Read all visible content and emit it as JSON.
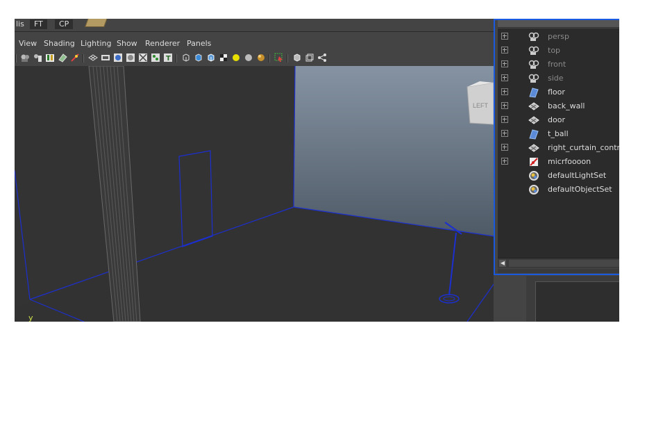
{
  "shelf": {
    "tabs": [
      {
        "label": "lis"
      },
      {
        "label": "FT"
      },
      {
        "label": "CP"
      }
    ]
  },
  "panel_menu": {
    "items": [
      "View",
      "Shading",
      "Lighting",
      "Show",
      "Renderer",
      "Panels"
    ]
  },
  "viewport": {
    "view_cube_label": "LEFT",
    "axis_label": "y",
    "wire_color": "#1c2fd0",
    "axis_color": "#d4e84a"
  },
  "outliner": {
    "items": [
      {
        "label": "persp",
        "icon": "camera-icon",
        "expandable": true,
        "dim": true
      },
      {
        "label": "top",
        "icon": "camera-icon",
        "expandable": true,
        "dim": true
      },
      {
        "label": "front",
        "icon": "camera-icon",
        "expandable": true,
        "dim": true
      },
      {
        "label": "side",
        "icon": "camera-icon",
        "expandable": true,
        "dim": true
      },
      {
        "label": "floor",
        "icon": "nurbs-plane-icon",
        "expandable": true,
        "dim": false
      },
      {
        "label": "back_wall",
        "icon": "mesh-icon",
        "expandable": true,
        "dim": false
      },
      {
        "label": "door",
        "icon": "mesh-icon",
        "expandable": true,
        "dim": false
      },
      {
        "label": "t_ball",
        "icon": "nurbs-plane-icon",
        "expandable": true,
        "dim": false
      },
      {
        "label": "right_curtain_control",
        "icon": "mesh-icon",
        "expandable": true,
        "dim": false
      },
      {
        "label": "micrfoooon",
        "icon": "joint-icon",
        "expandable": true,
        "dim": false
      },
      {
        "label": "defaultLightSet",
        "icon": "set-icon",
        "expandable": false,
        "dim": false
      },
      {
        "label": "defaultObjectSet",
        "icon": "set-icon",
        "expandable": false,
        "dim": false
      }
    ],
    "border_color": "#1a5ae0"
  }
}
